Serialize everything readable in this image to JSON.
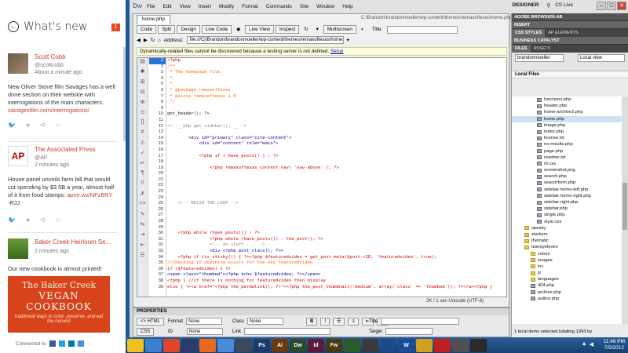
{
  "sidebar": {
    "title": "What's new",
    "count": "1",
    "tweets": [
      {
        "name": "Scott Cobb",
        "handle": "@scottcobb",
        "time": "About a minute ago",
        "body": "New Oliver Stone film Savages has a well done section on their website with interrogations of the main characters.",
        "link": "savagesfilm.com/interrogations/"
      },
      {
        "name": "The Associated Press",
        "handle": "@AP",
        "time": "2 minutes ago",
        "body": "House panel unveils farm bill that would cut spending by $3.5B a year, almost half of it from food stamps:",
        "link": "apne.ws/NFzBNY",
        "extra": "-RJJ"
      },
      {
        "name": "Baker Creek Heirloom Se...",
        "handle": "",
        "time": "2 minutes ago",
        "body": "Our new cookbook is almost printed!"
      }
    ],
    "book": {
      "line1": "The Baker Creek",
      "line2": "VEGAN COOKBOOK",
      "line3": "traditional ways to cook, preserve, and eat the harvest"
    },
    "connected": "Connected to"
  },
  "dw": {
    "menu": [
      "File",
      "Edit",
      "View",
      "Insert",
      "Modify",
      "Format",
      "Commands",
      "Site",
      "Window",
      "Help"
    ],
    "workspace": "DESIGNER",
    "cslive": "CS Live",
    "doc_tab": "home.php",
    "doc_path": "C:\\Brandon\\brandonmoeller\\wp-content\\themes\\remaxoftexas\\home.php",
    "views": [
      "Code",
      "Split",
      "Design",
      "Live Code",
      "",
      "Live View",
      "Inspect",
      "",
      "",
      "Multiscreen",
      "",
      ""
    ],
    "title_label": "Title:",
    "address_label": "Address:",
    "address": "file:///C|/Brandon/brandonmoeller/wp-content/themes/remaxoftexas/home.php",
    "info_bar": "Dynamically-related files cannot be discovered because a testing server is not defined.",
    "info_link": "Setup",
    "status": "2K / 1 sec  Unicode (UTF-8)",
    "lines": [
      {
        "n": "1",
        "t": "<?php",
        "c": "php"
      },
      {
        "n": "2",
        "t": "/**",
        "c": "com"
      },
      {
        "n": "3",
        "t": " * The homepage file.",
        "c": "com"
      },
      {
        "n": "4",
        "t": " *",
        "c": "com"
      },
      {
        "n": "5",
        "t": " *",
        "c": "com"
      },
      {
        "n": "6",
        "t": " * @package remaxoftexas",
        "c": "com"
      },
      {
        "n": "7",
        "t": " * @since remaxoftexas 1.0",
        "c": "com"
      },
      {
        "n": "8",
        "t": " */",
        "c": "com"
      },
      {
        "n": "9",
        "t": "",
        "c": "pl"
      },
      {
        "n": "10",
        "t": "get_header(); ?>",
        "c": "pl"
      },
      {
        "n": "11",
        "t": "",
        "c": "pl"
      },
      {
        "n": "12",
        "t": "<!--__php get_sidebar(); __-->",
        "c": "gray"
      },
      {
        "n": "13",
        "t": "",
        "c": "pl"
      },
      {
        "n": "14",
        "t": "        <div id=\"primary\" class=\"site-content\">",
        "c": "tag"
      },
      {
        "n": "15",
        "t": "            <div id=\"content\" role=\"main\">",
        "c": "tag"
      },
      {
        "n": "16",
        "t": "",
        "c": "pl"
      },
      {
        "n": "17",
        "t": "            <?php if ( have_posts() ) : ?>",
        "c": "php"
      },
      {
        "n": "18",
        "t": "",
        "c": "pl"
      },
      {
        "n": "19",
        "t": "                <?php remaxoftexas_content_nav( 'nav-above' ); ?>",
        "c": "php"
      },
      {
        "n": "20",
        "t": "",
        "c": "pl"
      },
      {
        "n": "21",
        "t": "",
        "c": "pl"
      },
      {
        "n": "22",
        "t": "",
        "c": "pl"
      },
      {
        "n": "23",
        "t": "",
        "c": "pl"
      },
      {
        "n": "24",
        "t": "",
        "c": "pl"
      },
      {
        "n": "25",
        "t": "    <!-- BEGIN THE LOOP -->",
        "c": "gray"
      },
      {
        "n": "26",
        "t": "",
        "c": "pl"
      },
      {
        "n": "27",
        "t": "",
        "c": "pl"
      },
      {
        "n": "28",
        "t": "",
        "c": "pl"
      },
      {
        "n": "29",
        "t": "",
        "c": "pl"
      },
      {
        "n": "30",
        "t": "    <?php while (have_posts()) : ?>",
        "c": "php"
      },
      {
        "n": "31",
        "t": "                <?php while (have_posts()) : the_post(); ?>",
        "c": "php"
      },
      {
        "n": "32",
        "t": "                <!-- do stuff ... -->",
        "c": "gray"
      },
      {
        "n": "33",
        "t": "                <div <?php post_class(); ?>>",
        "c": "tag"
      },
      {
        "n": "34",
        "t": "    <?php if (is_sticky()) { ?><?php $featuredvideo = get_post_meta($post->ID, 'featuredvideo', true);",
        "c": "php"
      },
      {
        "n": "35",
        "t": "//Checking if anything exists for the key featuredvideo",
        "c": "com"
      },
      {
        "n": "36",
        "t": "if ($featuredvideo) { ?>",
        "c": "php"
      },
      {
        "n": "37",
        "t": "<span class=\"thumbed\"><?php echo $featuredvideo; ?></span>",
        "c": "tag"
      },
      {
        "n": "38",
        "t": "<?php } //if there is nothing for featuredvideo then display",
        "c": "php"
      },
      {
        "n": "39",
        "t": "else { ?><a href=\"<?php the_permalink(); ?>\"><?php the_post_thumbnail('medium', array('class' => 'thumbed')); ?></a><?php }",
        "c": "php"
      }
    ],
    "props": {
      "title": "PROPERTIES",
      "html": "<> HTML",
      "css": "CSS",
      "format_label": "Format",
      "format_val": "None",
      "class_label": "Class",
      "class_val": "None",
      "id_label": "ID",
      "id_val": "None",
      "link_label": "Link",
      "title_label": "Title",
      "target_label": "Target"
    },
    "panels": {
      "browserlab": "ADOBE BROWSERLAB",
      "insert": "INSERT",
      "tabs1": [
        "CSS STYLES",
        "AP ELEMENTS"
      ],
      "catalyst": "BUSINESS CATALYST",
      "tabs2": [
        "FILES",
        "ASSETS"
      ],
      "site": "brandonmoeller",
      "view": "Local view",
      "local_files": "Local Files",
      "files": [
        {
          "n": "functions.php",
          "d": 8,
          "f": false
        },
        {
          "n": "header.php",
          "d": 8,
          "f": false
        },
        {
          "n": "home-archive2.php",
          "d": 8,
          "f": false
        },
        {
          "n": "home.php",
          "d": 8,
          "f": false,
          "h": true
        },
        {
          "n": "image.php",
          "d": 8,
          "f": false
        },
        {
          "n": "index.php",
          "d": 8,
          "f": false
        },
        {
          "n": "license.txt",
          "d": 8,
          "f": false
        },
        {
          "n": "no-results.php",
          "d": 8,
          "f": false
        },
        {
          "n": "page.php",
          "d": 8,
          "f": false
        },
        {
          "n": "readme.txt",
          "d": 8,
          "f": false
        },
        {
          "n": "rtl.css",
          "d": 8,
          "f": false
        },
        {
          "n": "screenshot.png",
          "d": 8,
          "f": false
        },
        {
          "n": "search.php",
          "d": 8,
          "f": false
        },
        {
          "n": "searchform.php",
          "d": 8,
          "f": false
        },
        {
          "n": "sidebar-home-left.php",
          "d": 8,
          "f": false
        },
        {
          "n": "sidebar-home-right.php",
          "d": 8,
          "f": false
        },
        {
          "n": "sidebar-right.php",
          "d": 8,
          "f": false
        },
        {
          "n": "sidebar.php",
          "d": 8,
          "f": false
        },
        {
          "n": "single.php",
          "d": 8,
          "f": false
        },
        {
          "n": "style.css",
          "d": 8,
          "f": false
        },
        {
          "n": "speaky",
          "d": 4,
          "f": true
        },
        {
          "n": "starkers",
          "d": 4,
          "f": true
        },
        {
          "n": "thematic",
          "d": 4,
          "f": true
        },
        {
          "n": "twentyeleven",
          "d": 4,
          "f": true
        },
        {
          "n": "colors",
          "d": 6,
          "f": true
        },
        {
          "n": "images",
          "d": 6,
          "f": true
        },
        {
          "n": "inc",
          "d": 6,
          "f": true
        },
        {
          "n": "js",
          "d": 6,
          "f": true
        },
        {
          "n": "languages",
          "d": 6,
          "f": true
        },
        {
          "n": "404.php",
          "d": 6,
          "f": false
        },
        {
          "n": "archive.php",
          "d": 6,
          "f": false
        },
        {
          "n": "author.php",
          "d": 6,
          "f": false
        }
      ],
      "status": "1 local items selected totalling 1993 by"
    }
  },
  "taskbar": {
    "apps": [
      {
        "l": "",
        "c": "#f0c020"
      },
      {
        "l": "",
        "c": "#3a7fd0"
      },
      {
        "l": "",
        "c": "#e0452a"
      },
      {
        "l": "",
        "c": "#2a3a6a"
      },
      {
        "l": "",
        "c": "#e86a1a"
      },
      {
        "l": "",
        "c": "#4a8ad8"
      },
      {
        "l": "",
        "c": "#3a4a5a"
      },
      {
        "l": "Ps",
        "c": "#1a3a6a"
      },
      {
        "l": "Ai",
        "c": "#6a3a10"
      },
      {
        "l": "Dw",
        "c": "#2a4a2a"
      },
      {
        "l": "Id",
        "c": "#5a1a3a"
      },
      {
        "l": "Fw",
        "c": "#4a3a10"
      },
      {
        "l": "",
        "c": "#2a5a2a"
      },
      {
        "l": "",
        "c": "#3a3a3a"
      },
      {
        "l": "",
        "c": "#1a4a8a"
      },
      {
        "l": "W",
        "c": "#1a4a9a"
      },
      {
        "l": "",
        "c": "#d0a020"
      },
      {
        "l": "",
        "c": "#c02020"
      },
      {
        "l": "",
        "c": "#505050"
      },
      {
        "l": "",
        "c": "#2a2a2a"
      }
    ],
    "time": "11:48 PM",
    "date": "7/5/2012"
  }
}
